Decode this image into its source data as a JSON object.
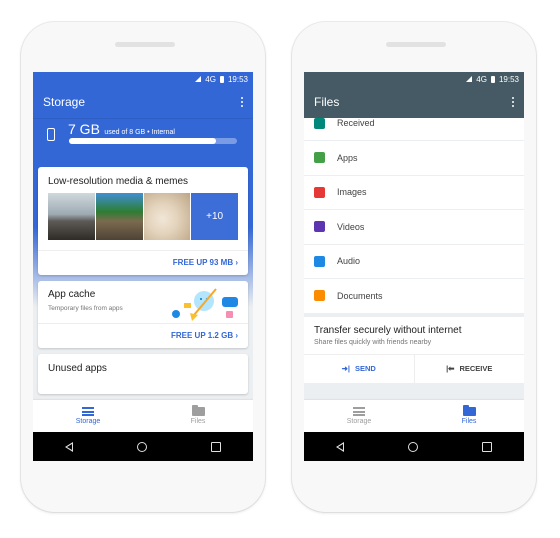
{
  "status_bar": {
    "network": "4G",
    "time": "19:53"
  },
  "storage_screen": {
    "title": "Storage",
    "summary": {
      "used_big": "7 GB",
      "used_detail": "used of 8 GB • Internal",
      "fraction_used": 0.875
    },
    "media_card": {
      "title": "Low-resolution media & memes",
      "more_count": "+10",
      "action": "FREE UP 93 MB"
    },
    "cache_card": {
      "title": "App cache",
      "subtitle": "Temporary files from apps",
      "action": "FREE UP 1.2 GB"
    },
    "unused_card": {
      "title": "Unused apps"
    },
    "bottom_nav": [
      {
        "label": "Storage",
        "active": true
      },
      {
        "label": "Files",
        "active": false
      }
    ]
  },
  "files_screen": {
    "title": "Files",
    "categories": [
      {
        "label": "Received",
        "color": "#00897b"
      },
      {
        "label": "Apps",
        "color": "#43a047"
      },
      {
        "label": "Images",
        "color": "#e53935"
      },
      {
        "label": "Videos",
        "color": "#5e35b1"
      },
      {
        "label": "Audio",
        "color": "#1e88e5"
      },
      {
        "label": "Documents",
        "color": "#fb8c00"
      }
    ],
    "transfer": {
      "title": "Transfer securely without internet",
      "subtitle": "Share files quickly with friends nearby",
      "send": "SEND",
      "receive": "RECEIVE"
    },
    "bottom_nav": [
      {
        "label": "Storage",
        "active": false
      },
      {
        "label": "Files",
        "active": true
      }
    ]
  },
  "colors": {
    "storage_accent": "#3367d6",
    "files_appbar": "#455a64"
  }
}
